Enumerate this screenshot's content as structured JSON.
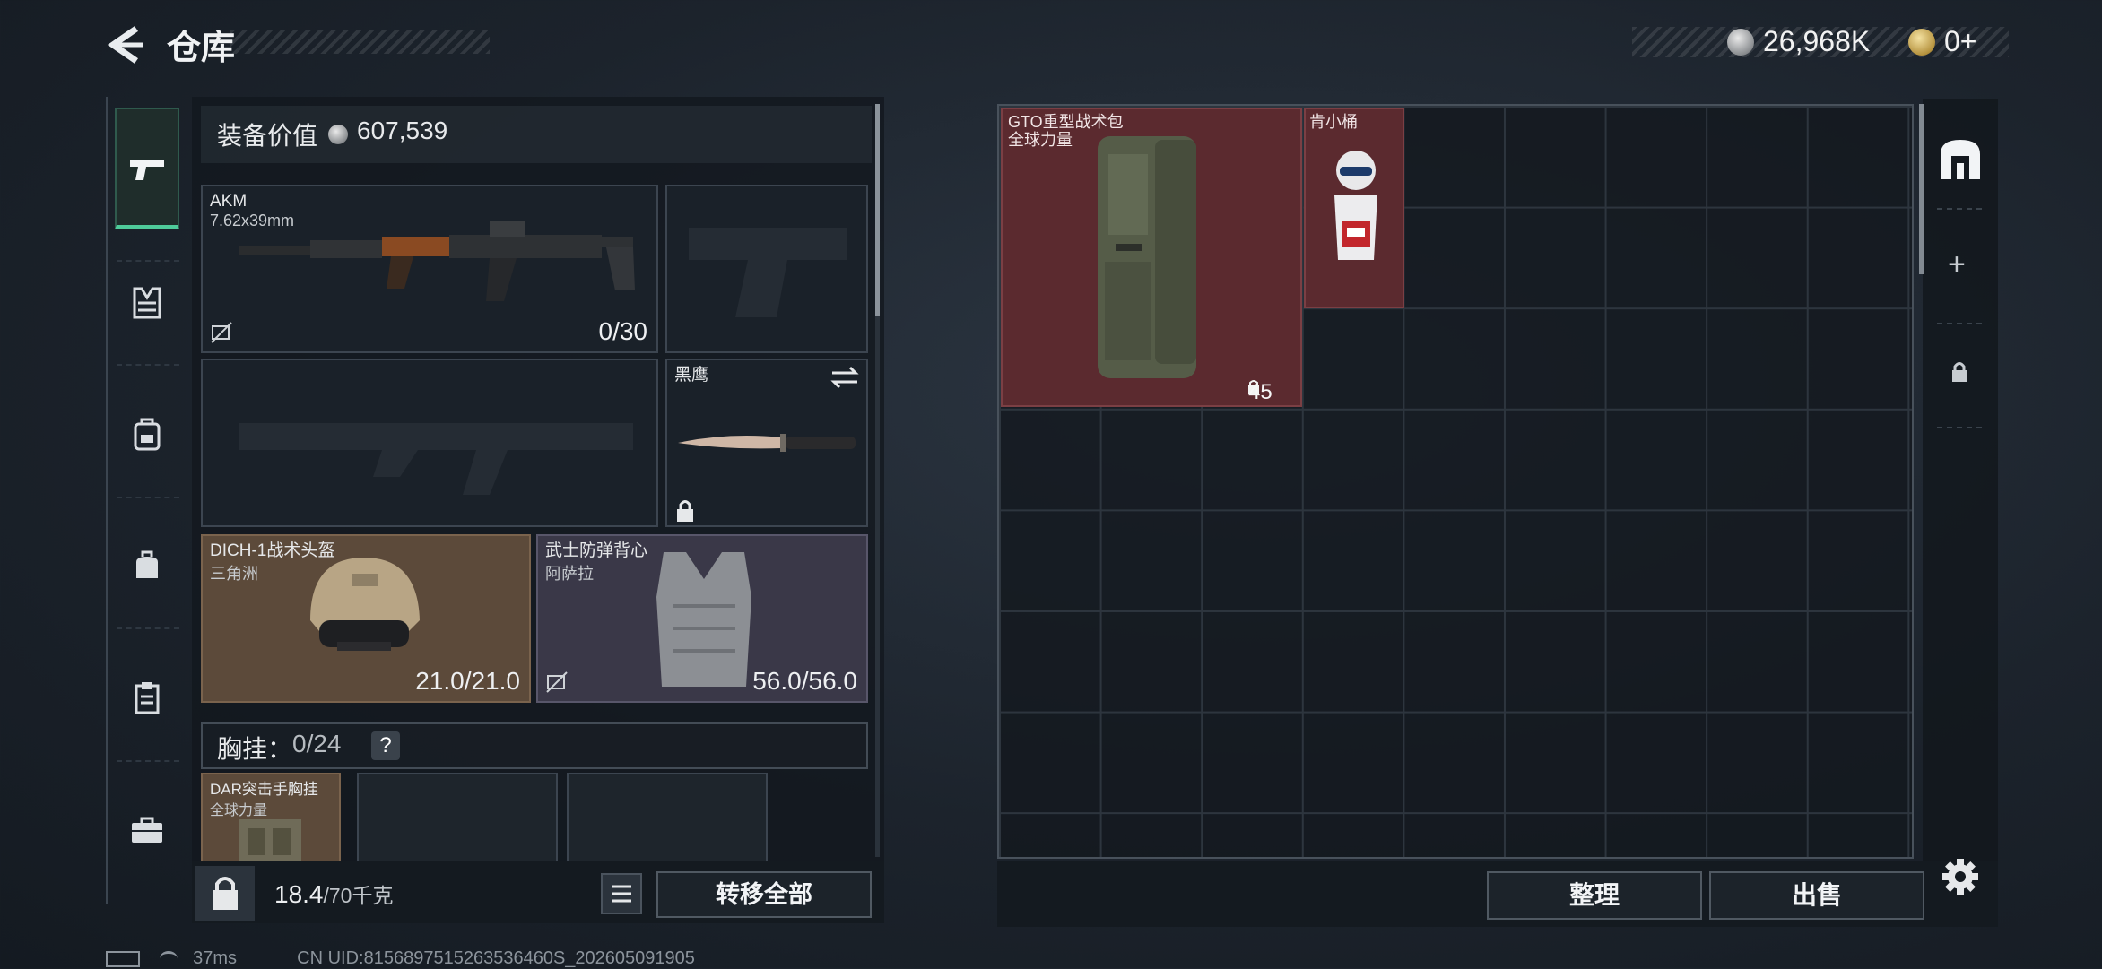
{
  "header": {
    "title": "仓库",
    "currency_silver": "26,968K",
    "currency_gold": "0+"
  },
  "sidebar": {
    "items": [
      {
        "icon": "pistol-icon",
        "active": true
      },
      {
        "icon": "chest-rig-icon"
      },
      {
        "icon": "backpack-icon"
      },
      {
        "icon": "pouch-bag-icon"
      },
      {
        "icon": "clipboard-icon"
      },
      {
        "icon": "briefcase-icon"
      }
    ]
  },
  "equipment": {
    "value_label": "装备价值",
    "value": "607,539",
    "primary_weapon": {
      "name": "AKM",
      "caliber": "7.62x39mm",
      "ammo": "0/30"
    },
    "melee": {
      "name": "黑鹰"
    },
    "helmet": {
      "name": "DICH-1战术头盔",
      "brand": "三角洲",
      "durability": "21.0/21.0"
    },
    "armor": {
      "name": "武士防弹背心",
      "brand": "阿萨拉",
      "durability": "56.0/56.0"
    },
    "chest_rig": {
      "label": "胸挂：",
      "capacity": "0/24",
      "help": "?",
      "item_name": "DAR突击手胸挂",
      "item_brand": "全球力量"
    }
  },
  "footer_left": {
    "weight": "18.4",
    "weight_unit": "/70千克",
    "transfer_all": "转移全部"
  },
  "stash": {
    "items": [
      {
        "name": "GTO重型战术包",
        "brand": "全球力量",
        "quantity": "45"
      },
      {
        "name": "肯小桶"
      }
    ]
  },
  "side_tools": {
    "add": "+"
  },
  "footer_right": {
    "organize": "整理",
    "sell": "出售"
  },
  "status_bar": {
    "ping": "37ms",
    "uid": "CN UID:8156897515263536460S_202605091905"
  },
  "colors": {
    "accent_green": "#4ecb9a",
    "item_red": "#5b2a2f",
    "helmet_tan": "#5c4a3a",
    "armor_purple": "#3a3848"
  }
}
